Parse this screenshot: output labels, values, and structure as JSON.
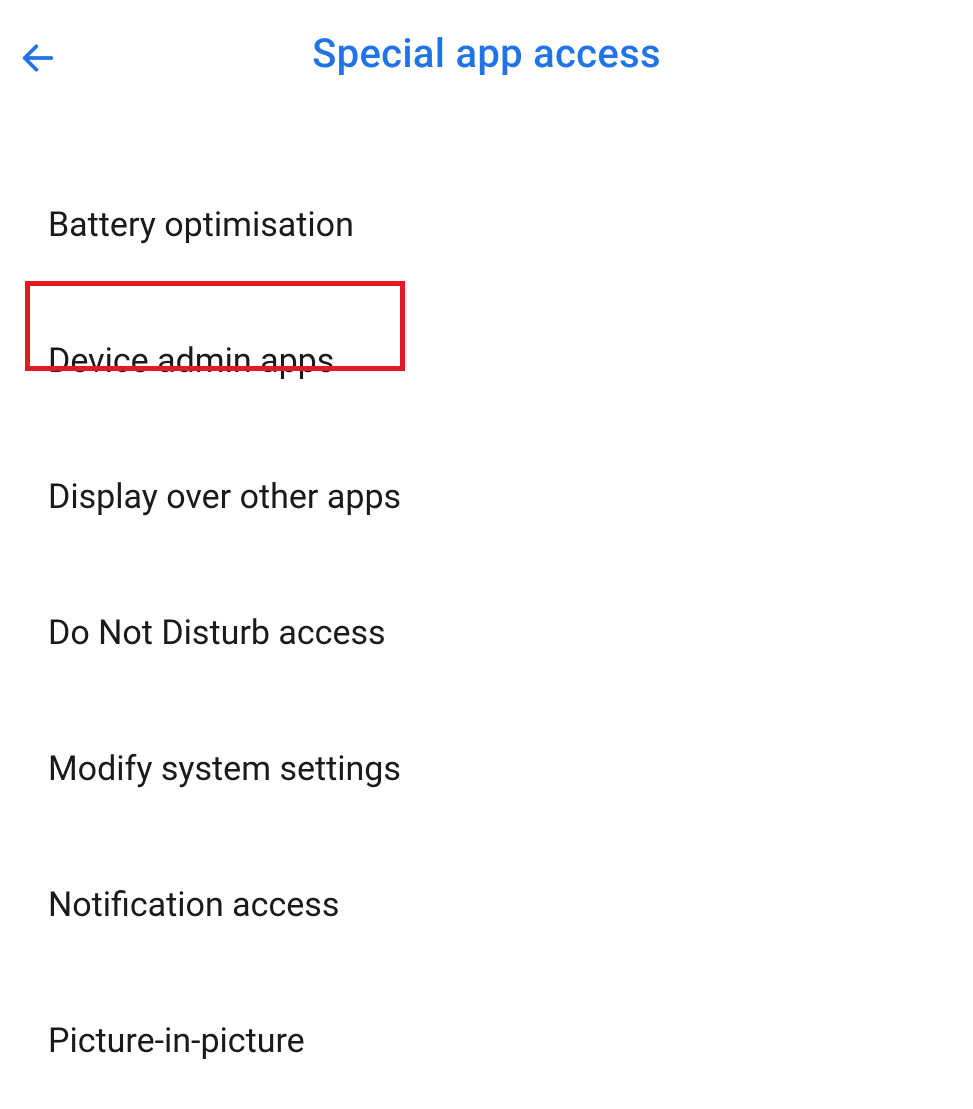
{
  "header": {
    "title": "Special app access"
  },
  "items": [
    {
      "label": "Battery optimisation",
      "key": "battery-optimisation"
    },
    {
      "label": "Device admin apps",
      "key": "device-admin-apps"
    },
    {
      "label": "Display over other apps",
      "key": "display-over-other-apps"
    },
    {
      "label": "Do Not Disturb access",
      "key": "do-not-disturb-access"
    },
    {
      "label": "Modify system settings",
      "key": "modify-system-settings"
    },
    {
      "label": "Notification access",
      "key": "notification-access"
    },
    {
      "label": "Picture-in-picture",
      "key": "picture-in-picture"
    }
  ],
  "annotation": {
    "highlighted_index": 1,
    "color": "#e01b24"
  }
}
